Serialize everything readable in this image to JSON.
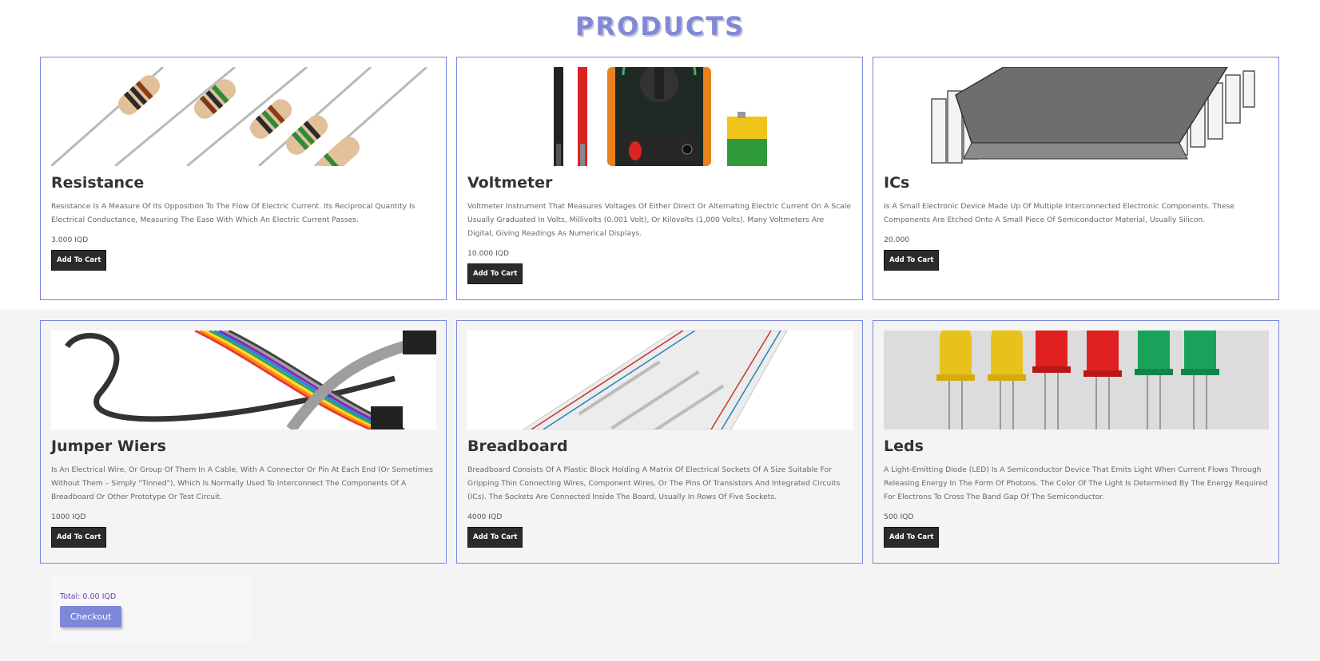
{
  "page": {
    "title": "PRODUCTS"
  },
  "products": [
    {
      "name": "Resistance",
      "description": "Resistance Is A Measure Of Its Opposition To The Flow Of Electric Current. Its Reciprocal Quantity Is Electrical Conductance, Measuring The Ease With Which An Electric Current Passes.",
      "price": "3.000 IQD",
      "button": "Add To Cart",
      "image_icon": "resistors-image"
    },
    {
      "name": "Voltmeter",
      "description": "Voltmeter Instrument That Measures Voltages Of Either Direct Or Alternating Electric Current On A Scale Usually Graduated In Volts, Millivolts (0.001 Volt), Or Kilovolts (1,000 Volts). Many Voltmeters Are Digital, Giving Readings As Numerical Displays.",
      "price": "10.000 IQD",
      "button": "Add To Cart",
      "image_icon": "multimeter-image"
    },
    {
      "name": "ICs",
      "description": "Is A Small Electronic Device Made Up Of Multiple Interconnected Electronic Components. These Components Are Etched Onto A Small Piece Of Semiconductor Material, Usually Silicon.",
      "price": "20.000",
      "button": "Add To Cart",
      "image_icon": "ic-chip-image"
    },
    {
      "name": "Jumper Wiers",
      "description": "Is An Electrical Wire, Or Group Of Them In A Cable, With A Connector Or Pin At Each End (Or Sometimes Without Them – Simply \"Tinned\"), Which Is Normally Used To Interconnect The Components Of A Breadboard Or Other Prototype Or Test Circuit.",
      "price": "1000 IQD",
      "button": "Add To Cart",
      "image_icon": "jumper-wires-image"
    },
    {
      "name": "Breadboard",
      "description": "Breadboard Consists Of A Plastic Block Holding A Matrix Of Electrical Sockets Of A Size Suitable For Gripping Thin Connecting Wires, Component Wires, Or The Pins Of Transistors And Integrated Circuits (ICs). The Sockets Are Connected Inside The Board, Usually In Rows Of Five Sockets.",
      "price": "4000 IQD",
      "button": "Add To Cart",
      "image_icon": "breadboard-image"
    },
    {
      "name": "Leds",
      "description": "A Light-Emitting Diode (LED) Is A Semiconductor Device That Emits Light When Current Flows Through Releasing Energy In The Form Of Photons. The Color Of The Light Is Determined By The Energy Required For Electrons To Cross The Band Gap Of The Semiconductor.",
      "price": "500 IQD",
      "button": "Add To Cart",
      "image_icon": "leds-image"
    }
  ],
  "cart": {
    "total": "Total: 0.00 IQD",
    "checkout": "Checkout"
  },
  "colors": {
    "accent": "#7e88d8",
    "card_border": "#7a86e0",
    "button_dark": "#2b2b2b",
    "total_text": "#6a40a8"
  }
}
